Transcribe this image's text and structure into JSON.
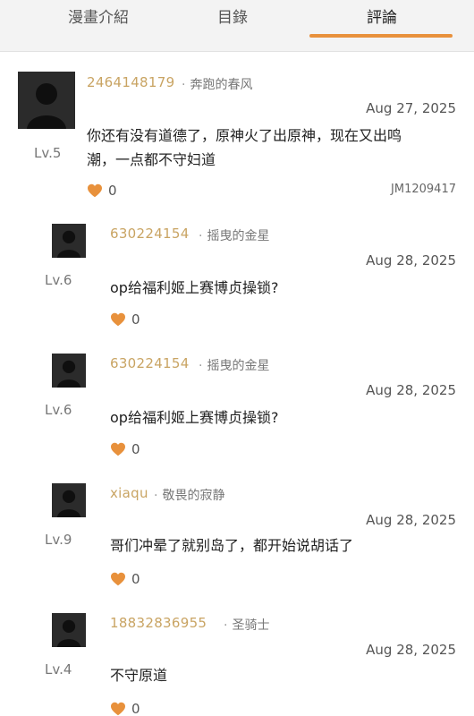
{
  "tabs": [
    {
      "label": "漫畫介紹",
      "active": false
    },
    {
      "label": "目錄",
      "active": false
    },
    {
      "label": "評論",
      "active": true
    }
  ],
  "accent_color": "#e8913c",
  "comments": [
    {
      "uid": "2464148179",
      "nickname": "奔跑的春风",
      "date": "Aug 27, 2025",
      "level": "Lv.5",
      "text_lines": [
        "你还有没有道德了，原神火了出原神，现在又出鸣",
        "潮，一点都不守妇道"
      ],
      "likes": "0",
      "ref": "JM1209417"
    },
    {
      "uid": "630224154",
      "nickname": "摇曳的金星",
      "date": "Aug 28, 2025",
      "level": "Lv.6",
      "text_lines": [
        "op给福利姬上赛博贞操锁?"
      ],
      "likes": "0"
    },
    {
      "uid": "630224154",
      "nickname": "摇曳的金星",
      "date": "Aug 28, 2025",
      "level": "Lv.6",
      "text_lines": [
        "op给福利姬上赛博贞操锁?"
      ],
      "likes": "0"
    },
    {
      "uid": "xiaqu",
      "nickname": "敬畏的寂静",
      "date": "Aug 28, 2025",
      "level": "Lv.9",
      "text_lines": [
        "哥们冲晕了就别岛了，都开始说胡话了"
      ],
      "likes": "0"
    },
    {
      "uid": "18832836955",
      "nickname": "圣骑士",
      "date": "Aug 28, 2025",
      "level": "Lv.4",
      "text_lines": [
        "不守原道"
      ],
      "likes": "0"
    }
  ]
}
